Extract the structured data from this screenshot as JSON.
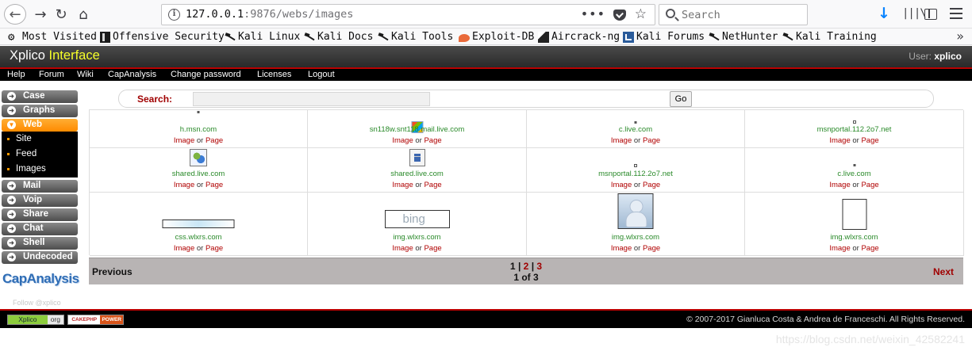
{
  "browser": {
    "url_host": "127.0.0.1",
    "url_rest": ":9876/webs/images",
    "search_placeholder": "Search",
    "bookmarks": [
      {
        "label": "Most Visited",
        "icon": "gear-icon"
      },
      {
        "label": "Offensive Security",
        "icon": "offsec-icon"
      },
      {
        "label": "Kali Linux",
        "icon": "kali-dragon-icon"
      },
      {
        "label": "Kali Docs",
        "icon": "kali-dragon-icon"
      },
      {
        "label": "Kali Tools",
        "icon": "kali-dragon-icon"
      },
      {
        "label": "Exploit-DB",
        "icon": "exploit-db-icon"
      },
      {
        "label": "Aircrack-ng",
        "icon": "aircrack-icon"
      },
      {
        "label": "Kali Forums",
        "icon": "kali-forums-icon"
      },
      {
        "label": "NetHunter",
        "icon": "kali-dragon-icon"
      },
      {
        "label": "Kali Training",
        "icon": "kali-dragon-icon"
      }
    ]
  },
  "app": {
    "title_main": "Xplico",
    "title_accent": "Interface",
    "user_label": "User:",
    "user_name": "xplico"
  },
  "nav": [
    "Help",
    "Forum",
    "Wiki",
    "CapAnalysis",
    "Change password",
    "Licenses",
    "Logout"
  ],
  "menu": {
    "case": "Case",
    "graphs": "Graphs",
    "web": "Web",
    "web_sub": [
      "Site",
      "Feed",
      "Images"
    ],
    "mail": "Mail",
    "voip": "Voip",
    "share": "Share",
    "chat": "Chat",
    "shell": "Shell",
    "undecoded": "Undecoded",
    "capanalysis_logo": "CapAnalysis",
    "follow": "Follow @xplico"
  },
  "search": {
    "label": "Search:",
    "value": "",
    "go": "Go"
  },
  "images": {
    "image_link": "Image",
    "or": "or",
    "page_link": "Page",
    "rows": [
      [
        {
          "host": "h.msn.com",
          "thumb": "tiny-dot"
        },
        {
          "host": "sn118w.snt118.mail.live.com",
          "thumb": "windows-logo"
        },
        {
          "host": "c.live.com",
          "thumb": "tiny-dot"
        },
        {
          "host": "msnportal.112.2o7.net",
          "thumb": "tiny-box"
        }
      ],
      [
        {
          "host": "shared.live.com",
          "thumb": "people-icon"
        },
        {
          "host": "shared.live.com",
          "thumb": "document-icon"
        },
        {
          "host": "msnportal.112.2o7.net",
          "thumb": "tiny-box"
        },
        {
          "host": "c.live.com",
          "thumb": "tiny-dot"
        }
      ],
      [
        {
          "host": "css.wlxrs.com",
          "thumb": "banner"
        },
        {
          "host": "img.wlxrs.com",
          "thumb": "bing-logo",
          "thumb_text": "bing"
        },
        {
          "host": "img.wlxrs.com",
          "thumb": "avatar"
        },
        {
          "host": "img.wlxrs.com",
          "thumb": "blank-page"
        }
      ]
    ]
  },
  "pagination": {
    "previous": "Previous",
    "next": "Next",
    "pages": [
      "1",
      "2",
      "3"
    ],
    "current_page": 1,
    "sep": "|",
    "page_of": "1 of 3"
  },
  "footer": {
    "badge_xplico_left": "Xplico",
    "badge_xplico_right": "org",
    "badge_cake_left": "CAKEPHP",
    "badge_cake_right": "POWER",
    "copyright": "© 2007-2017 Gianluca Costa & Andrea de Franceschi. All Rights Reserved.",
    "watermark": "https://blog.csdn.net/weixin_42582241"
  }
}
